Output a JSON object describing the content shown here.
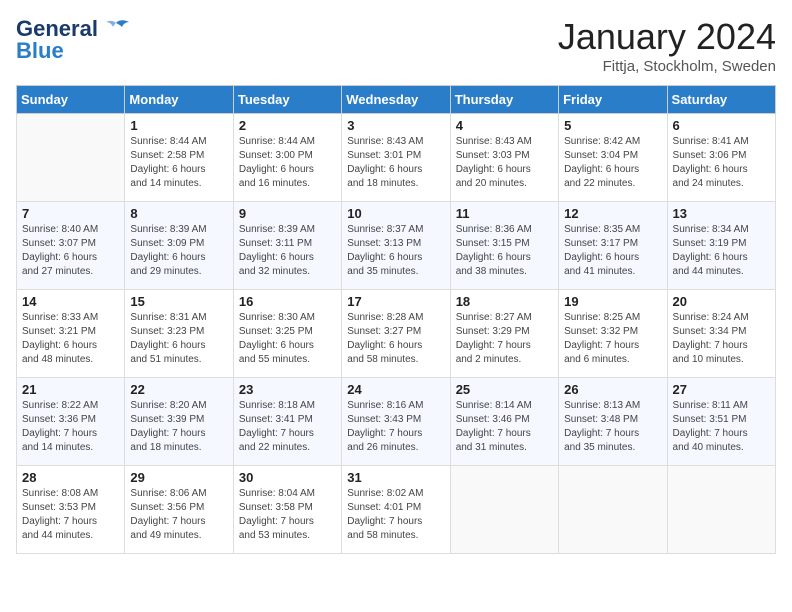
{
  "header": {
    "logo_general": "General",
    "logo_blue": "Blue",
    "month": "January 2024",
    "location": "Fittja, Stockholm, Sweden"
  },
  "days_of_week": [
    "Sunday",
    "Monday",
    "Tuesday",
    "Wednesday",
    "Thursday",
    "Friday",
    "Saturday"
  ],
  "weeks": [
    [
      {
        "day": "",
        "info": ""
      },
      {
        "day": "1",
        "info": "Sunrise: 8:44 AM\nSunset: 2:58 PM\nDaylight: 6 hours\nand 14 minutes."
      },
      {
        "day": "2",
        "info": "Sunrise: 8:44 AM\nSunset: 3:00 PM\nDaylight: 6 hours\nand 16 minutes."
      },
      {
        "day": "3",
        "info": "Sunrise: 8:43 AM\nSunset: 3:01 PM\nDaylight: 6 hours\nand 18 minutes."
      },
      {
        "day": "4",
        "info": "Sunrise: 8:43 AM\nSunset: 3:03 PM\nDaylight: 6 hours\nand 20 minutes."
      },
      {
        "day": "5",
        "info": "Sunrise: 8:42 AM\nSunset: 3:04 PM\nDaylight: 6 hours\nand 22 minutes."
      },
      {
        "day": "6",
        "info": "Sunrise: 8:41 AM\nSunset: 3:06 PM\nDaylight: 6 hours\nand 24 minutes."
      }
    ],
    [
      {
        "day": "7",
        "info": "Sunrise: 8:40 AM\nSunset: 3:07 PM\nDaylight: 6 hours\nand 27 minutes."
      },
      {
        "day": "8",
        "info": "Sunrise: 8:39 AM\nSunset: 3:09 PM\nDaylight: 6 hours\nand 29 minutes."
      },
      {
        "day": "9",
        "info": "Sunrise: 8:39 AM\nSunset: 3:11 PM\nDaylight: 6 hours\nand 32 minutes."
      },
      {
        "day": "10",
        "info": "Sunrise: 8:37 AM\nSunset: 3:13 PM\nDaylight: 6 hours\nand 35 minutes."
      },
      {
        "day": "11",
        "info": "Sunrise: 8:36 AM\nSunset: 3:15 PM\nDaylight: 6 hours\nand 38 minutes."
      },
      {
        "day": "12",
        "info": "Sunrise: 8:35 AM\nSunset: 3:17 PM\nDaylight: 6 hours\nand 41 minutes."
      },
      {
        "day": "13",
        "info": "Sunrise: 8:34 AM\nSunset: 3:19 PM\nDaylight: 6 hours\nand 44 minutes."
      }
    ],
    [
      {
        "day": "14",
        "info": "Sunrise: 8:33 AM\nSunset: 3:21 PM\nDaylight: 6 hours\nand 48 minutes."
      },
      {
        "day": "15",
        "info": "Sunrise: 8:31 AM\nSunset: 3:23 PM\nDaylight: 6 hours\nand 51 minutes."
      },
      {
        "day": "16",
        "info": "Sunrise: 8:30 AM\nSunset: 3:25 PM\nDaylight: 6 hours\nand 55 minutes."
      },
      {
        "day": "17",
        "info": "Sunrise: 8:28 AM\nSunset: 3:27 PM\nDaylight: 6 hours\nand 58 minutes."
      },
      {
        "day": "18",
        "info": "Sunrise: 8:27 AM\nSunset: 3:29 PM\nDaylight: 7 hours\nand 2 minutes."
      },
      {
        "day": "19",
        "info": "Sunrise: 8:25 AM\nSunset: 3:32 PM\nDaylight: 7 hours\nand 6 minutes."
      },
      {
        "day": "20",
        "info": "Sunrise: 8:24 AM\nSunset: 3:34 PM\nDaylight: 7 hours\nand 10 minutes."
      }
    ],
    [
      {
        "day": "21",
        "info": "Sunrise: 8:22 AM\nSunset: 3:36 PM\nDaylight: 7 hours\nand 14 minutes."
      },
      {
        "day": "22",
        "info": "Sunrise: 8:20 AM\nSunset: 3:39 PM\nDaylight: 7 hours\nand 18 minutes."
      },
      {
        "day": "23",
        "info": "Sunrise: 8:18 AM\nSunset: 3:41 PM\nDaylight: 7 hours\nand 22 minutes."
      },
      {
        "day": "24",
        "info": "Sunrise: 8:16 AM\nSunset: 3:43 PM\nDaylight: 7 hours\nand 26 minutes."
      },
      {
        "day": "25",
        "info": "Sunrise: 8:14 AM\nSunset: 3:46 PM\nDaylight: 7 hours\nand 31 minutes."
      },
      {
        "day": "26",
        "info": "Sunrise: 8:13 AM\nSunset: 3:48 PM\nDaylight: 7 hours\nand 35 minutes."
      },
      {
        "day": "27",
        "info": "Sunrise: 8:11 AM\nSunset: 3:51 PM\nDaylight: 7 hours\nand 40 minutes."
      }
    ],
    [
      {
        "day": "28",
        "info": "Sunrise: 8:08 AM\nSunset: 3:53 PM\nDaylight: 7 hours\nand 44 minutes."
      },
      {
        "day": "29",
        "info": "Sunrise: 8:06 AM\nSunset: 3:56 PM\nDaylight: 7 hours\nand 49 minutes."
      },
      {
        "day": "30",
        "info": "Sunrise: 8:04 AM\nSunset: 3:58 PM\nDaylight: 7 hours\nand 53 minutes."
      },
      {
        "day": "31",
        "info": "Sunrise: 8:02 AM\nSunset: 4:01 PM\nDaylight: 7 hours\nand 58 minutes."
      },
      {
        "day": "",
        "info": ""
      },
      {
        "day": "",
        "info": ""
      },
      {
        "day": "",
        "info": ""
      }
    ]
  ]
}
